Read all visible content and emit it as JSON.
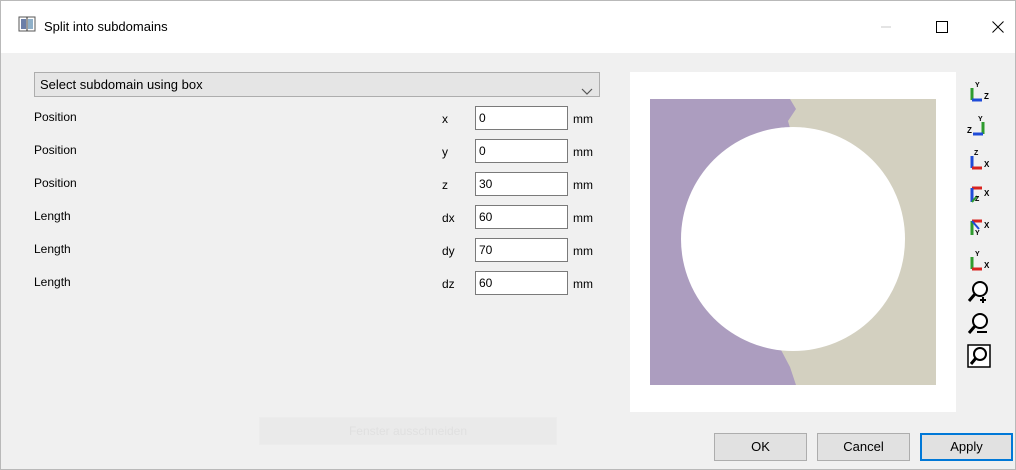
{
  "window": {
    "title": "Split into subdomains",
    "minimize_label": "—",
    "maximize_label": "☐",
    "close_label": "✕"
  },
  "mode_select": {
    "selected": "Select subdomain using box"
  },
  "params": [
    {
      "label": "Position",
      "axis": "x",
      "value": "0",
      "unit": "mm"
    },
    {
      "label": "Position",
      "axis": "y",
      "value": "0",
      "unit": "mm"
    },
    {
      "label": "Position",
      "axis": "z",
      "value": "30",
      "unit": "mm"
    },
    {
      "label": "Length",
      "axis": "dx",
      "value": "60",
      "unit": "mm"
    },
    {
      "label": "Length",
      "axis": "dy",
      "value": "70",
      "unit": "mm"
    },
    {
      "label": "Length",
      "axis": "dz",
      "value": "60",
      "unit": "mm"
    }
  ],
  "ghost_button": {
    "label": "Fenster ausschneiden"
  },
  "view_toolbar": {
    "icons": [
      "view-yz-icon",
      "view-zy-icon",
      "view-zx-icon",
      "view-xz-icon",
      "view-yx-icon",
      "view-xy-icon",
      "zoom-in-icon",
      "zoom-out-icon",
      "zoom-fit-icon"
    ]
  },
  "buttons": {
    "ok": "OK",
    "cancel": "Cancel",
    "apply": "Apply"
  },
  "colors": {
    "accent": "#0078d7",
    "region_purple": "#ac9dbf",
    "region_beige": "#d3d0c0",
    "axis_green": "#2e9b2e",
    "axis_blue": "#1f4bd8",
    "axis_red": "#d8231f"
  }
}
